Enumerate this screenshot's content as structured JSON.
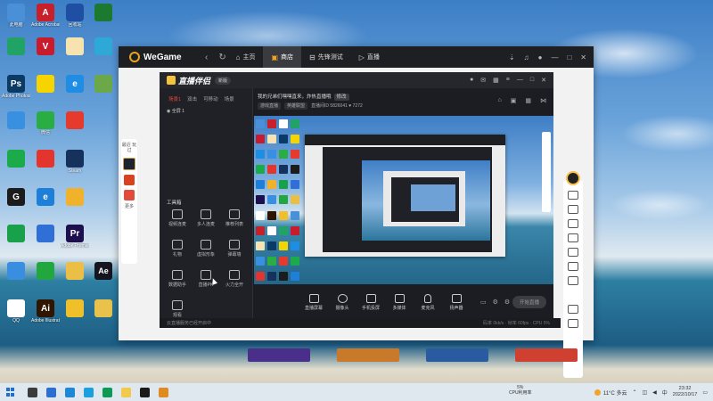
{
  "desktop_icons": [
    {
      "label": "此电脑",
      "color": "#4a90d9",
      "glyph": ""
    },
    {
      "label": "Adobe Acrobat DC",
      "color": "#c8202a",
      "glyph": "A"
    },
    {
      "label": "回收站",
      "color": "#ffffff",
      "glyph": ""
    },
    {
      "label": "",
      "color": "#21a366",
      "glyph": ""
    },
    {
      "label": "",
      "color": "#c81c2c",
      "glyph": "V"
    },
    {
      "label": "",
      "color": "#f7e3b0",
      "glyph": ""
    },
    {
      "label": "Adobe Photosh...",
      "color": "#0b3a66",
      "glyph": "Ps"
    },
    {
      "label": "",
      "color": "#f5d400",
      "glyph": ""
    },
    {
      "label": "",
      "color": "#1e8de3",
      "glyph": "e"
    },
    {
      "label": "",
      "color": "#3a90e0",
      "glyph": ""
    },
    {
      "label": "微信",
      "color": "#2aae43",
      "glyph": ""
    },
    {
      "label": "",
      "color": "#e63a2c",
      "glyph": ""
    },
    {
      "label": "",
      "color": "#1bab4a",
      "glyph": ""
    },
    {
      "label": "",
      "color": "#e3352d",
      "glyph": ""
    },
    {
      "label": "Steam",
      "color": "#16325c",
      "glyph": ""
    },
    {
      "label": "",
      "color": "#1c1c1c",
      "glyph": "G"
    },
    {
      "label": "",
      "color": "#1d7fd8",
      "glyph": "e"
    },
    {
      "label": "",
      "color": "#f0b22a",
      "glyph": ""
    },
    {
      "label": "",
      "color": "#18a04a",
      "glyph": ""
    },
    {
      "label": "",
      "color": "#2f6fd6",
      "glyph": ""
    },
    {
      "label": "Adobe Premie...",
      "color": "#1e0f4e",
      "glyph": "Pr"
    },
    {
      "label": "",
      "color": "#3a8ee0",
      "glyph": ""
    },
    {
      "label": "",
      "color": "#22a63e",
      "glyph": ""
    },
    {
      "label": "",
      "color": "#ebbf45",
      "glyph": ""
    },
    {
      "label": "QQ",
      "color": "#ffffff",
      "glyph": ""
    },
    {
      "label": "Adobe Illustrat...",
      "color": "#301600",
      "glyph": "Ai"
    },
    {
      "label": "",
      "color": "#f0c02a",
      "glyph": ""
    }
  ],
  "desktop_extra_icons": [
    {
      "color": "#1f4fa3"
    },
    {
      "color": "#1b7a2f"
    },
    {
      "color": "#2ea8d6"
    },
    {
      "color": "#6aa84a"
    },
    {
      "color": "#14151e",
      "glyph": "Ae"
    },
    {
      "color": "#e8c24a"
    }
  ],
  "wegame": {
    "logo": "WeGame",
    "tabs": [
      {
        "label": "主页",
        "icon": "home-icon",
        "active": false
      },
      {
        "label": "商店",
        "icon": "shop-icon",
        "active": true
      },
      {
        "label": "先锋测试",
        "icon": "test-icon",
        "active": false
      },
      {
        "label": "直播",
        "icon": "live-icon",
        "active": false
      }
    ],
    "left_rail_label": "最近 玩过",
    "left_rail_more": "更多",
    "thumb_colors": [
      "#4a2f8a",
      "#c87a2a",
      "#2a5aa0",
      "#d04030"
    ]
  },
  "zhibo": {
    "title": "直播伴侣",
    "version": "新版",
    "scene_tabs": [
      {
        "label": "场景1",
        "on": true
      },
      {
        "label": "双击",
        "on": false
      },
      {
        "label": "可移动",
        "on": false
      },
      {
        "label": "场景",
        "on": false
      }
    ],
    "scene_item": "全屏 1",
    "tool_title": "工具箱",
    "tools": [
      {
        "label": "视频连麦"
      },
      {
        "label": "多人连麦"
      },
      {
        "label": "推荐列表"
      },
      {
        "label": "礼物"
      },
      {
        "label": "虚拟形象"
      },
      {
        "label": "弹幕墙"
      },
      {
        "label": "数据助手"
      },
      {
        "label": "直播PK"
      },
      {
        "label": "火力全开"
      },
      {
        "label": "观看"
      }
    ],
    "room_line": "我的兄弟们嘿嘿直来，炸热直播哦",
    "room_btn": "修改",
    "room_tags": [
      "游戏直播",
      "英雄联盟",
      "直播间ID 5826041"
    ],
    "room_fans": "7272",
    "controls": [
      {
        "label": "直播屏幕"
      },
      {
        "label": "摄像头"
      },
      {
        "label": "手机投屏"
      },
      {
        "label": "多媒体"
      },
      {
        "label": "麦克风"
      },
      {
        "label": "扬声器"
      }
    ],
    "start_label": "开始直播",
    "bottom_tip": "云直播服务已经开启中",
    "bottom_stats": "码率 0kb/s · 帧率 60fps · CPU 5%",
    "inner_logo": "WeGame"
  },
  "taskbar": {
    "cpu_line1": "5%",
    "cpu_line2": "CPU利用率",
    "weather": "11°C 多云",
    "time": "23:32",
    "date": "2022/10/17",
    "colors": [
      "#3b3b3b",
      "#2d6fd0",
      "#1e88d8",
      "#1aa0e0",
      "#0c9a54",
      "#f2c94a",
      "#1a1a1a",
      "#e08a1f"
    ]
  }
}
